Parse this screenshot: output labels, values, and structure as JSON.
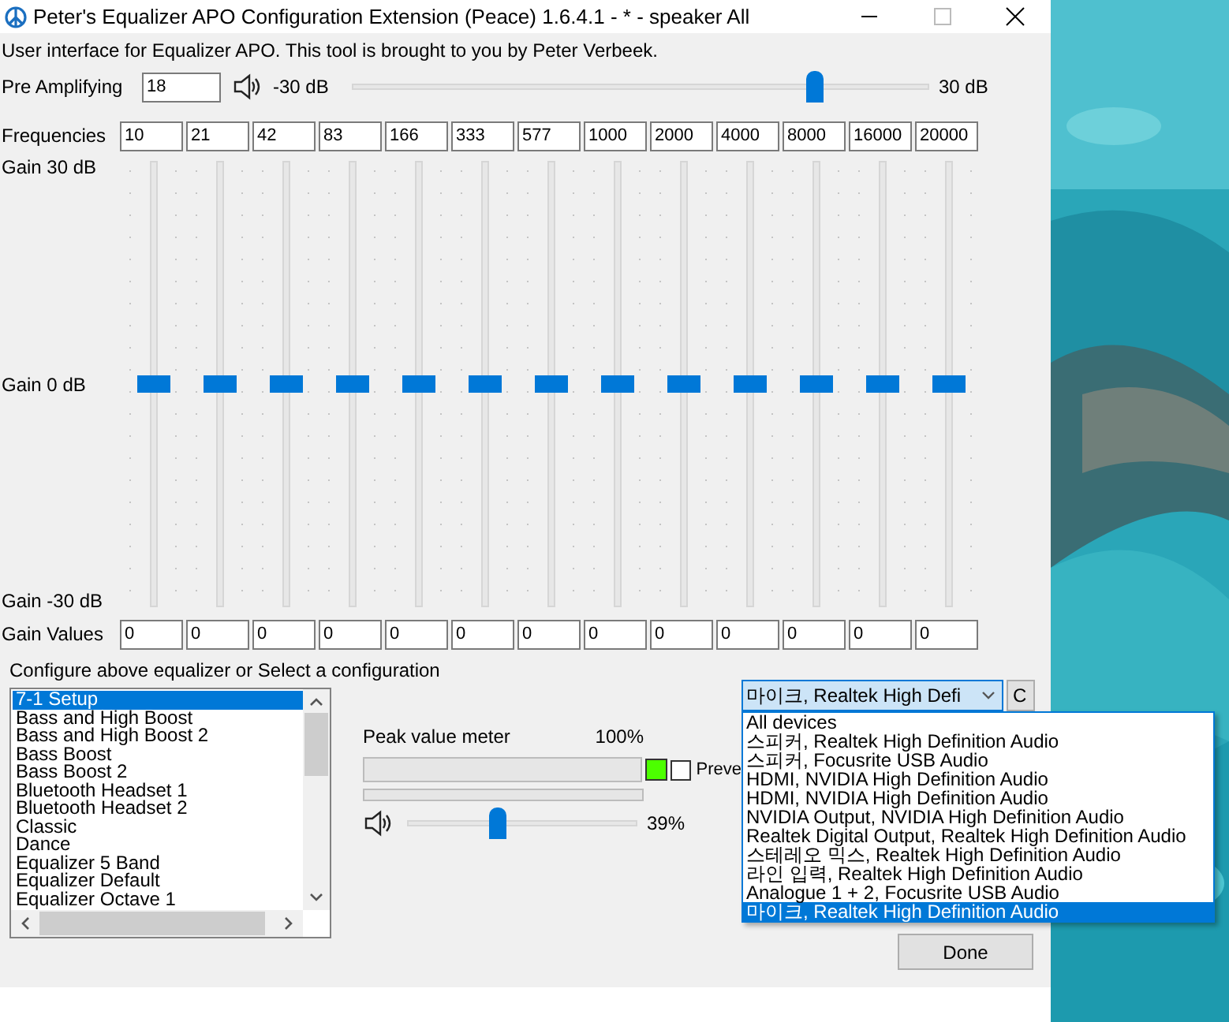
{
  "window": {
    "title": "Peter's Equalizer APO Configuration Extension (Peace) 1.6.4.1 - * - speaker All"
  },
  "intro": "User interface for Equalizer APO. This tool is brought to you by Peter Verbeek.",
  "pre_amp": {
    "label": "Pre Amplifying",
    "value": "18",
    "min_label": "-30 dB",
    "max_label": "30 dB",
    "level": 0.8
  },
  "frequencies_label": "Frequencies",
  "gain_labels": {
    "top": "Gain 30 dB",
    "middle": "Gain 0 dB",
    "bottom": "Gain -30 dB"
  },
  "gain_values_label": "Gain Values",
  "bands": [
    {
      "frequency": "10",
      "gain": "0",
      "level": 0.5
    },
    {
      "frequency": "21",
      "gain": "0",
      "level": 0.5
    },
    {
      "frequency": "42",
      "gain": "0",
      "level": 0.5
    },
    {
      "frequency": "83",
      "gain": "0",
      "level": 0.5
    },
    {
      "frequency": "166",
      "gain": "0",
      "level": 0.5
    },
    {
      "frequency": "333",
      "gain": "0",
      "level": 0.5
    },
    {
      "frequency": "577",
      "gain": "0",
      "level": 0.5
    },
    {
      "frequency": "1000",
      "gain": "0",
      "level": 0.5
    },
    {
      "frequency": "2000",
      "gain": "0",
      "level": 0.5
    },
    {
      "frequency": "4000",
      "gain": "0",
      "level": 0.5
    },
    {
      "frequency": "8000",
      "gain": "0",
      "level": 0.5
    },
    {
      "frequency": "16000",
      "gain": "0",
      "level": 0.5
    },
    {
      "frequency": "20000",
      "gain": "0",
      "level": 0.5
    }
  ],
  "configure_label": "Configure above equalizer or Select a configuration",
  "configurations": [
    {
      "label": "7-1 Setup",
      "selected": true
    },
    {
      "label": "Bass and High Boost",
      "selected": false
    },
    {
      "label": "Bass and High Boost 2",
      "selected": false
    },
    {
      "label": "Bass Boost",
      "selected": false
    },
    {
      "label": "Bass Boost 2",
      "selected": false
    },
    {
      "label": "Bluetooth Headset 1",
      "selected": false
    },
    {
      "label": "Bluetooth Headset 2",
      "selected": false
    },
    {
      "label": "Classic",
      "selected": false
    },
    {
      "label": "Dance",
      "selected": false
    },
    {
      "label": "Equalizer 5 Band",
      "selected": false
    },
    {
      "label": "Equalizer Default",
      "selected": false
    },
    {
      "label": "Equalizer Octave 1",
      "selected": false
    }
  ],
  "peak_meter": {
    "label": "Peak value meter",
    "max_label": "100%",
    "preview_label": "Preve",
    "preview_checked": false
  },
  "volume": {
    "level": 0.39,
    "reading": "39%"
  },
  "device_select": {
    "value": "마이크, Realtek High Defi",
    "side_button": "C"
  },
  "device_options": [
    {
      "label": "All devices",
      "selected": false
    },
    {
      "label": "스피커, Realtek High Definition Audio",
      "selected": false
    },
    {
      "label": "스피커, Focusrite USB Audio",
      "selected": false
    },
    {
      "label": "HDMI, NVIDIA High Definition Audio",
      "selected": false
    },
    {
      "label": "HDMI, NVIDIA High Definition Audio",
      "selected": false
    },
    {
      "label": "NVIDIA Output, NVIDIA High Definition Audio",
      "selected": false
    },
    {
      "label": "Realtek Digital Output, Realtek High Definition Audio",
      "selected": false
    },
    {
      "label": "스테레오 믹스, Realtek High Definition Audio",
      "selected": false
    },
    {
      "label": "라인 입력, Realtek High Definition Audio",
      "selected": false
    },
    {
      "label": "Analogue 1 + 2, Focusrite USB Audio",
      "selected": false
    },
    {
      "label": "마이크, Realtek High Definition Audio",
      "selected": true
    }
  ],
  "done_button": "Done"
}
